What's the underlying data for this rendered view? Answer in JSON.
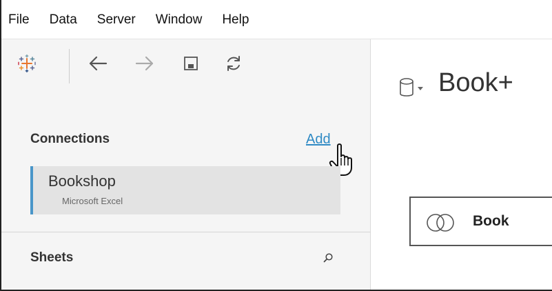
{
  "menubar": {
    "items": [
      "File",
      "Data",
      "Server",
      "Window",
      "Help"
    ]
  },
  "toolbar": {
    "logo": "tableau-logo-icon",
    "buttons": [
      "back-arrow-icon",
      "forward-arrow-icon",
      "save-icon",
      "refresh-icon"
    ]
  },
  "connections": {
    "title": "Connections",
    "add_label": "Add",
    "items": [
      {
        "name": "Bookshop",
        "type": "Microsoft Excel"
      }
    ]
  },
  "sheets": {
    "title": "Sheets",
    "search_icon": "search-icon"
  },
  "canvas": {
    "datasource_name": "Book+",
    "datasource_icon": "database-cylinder-icon",
    "table": {
      "name": "Book",
      "icon": "join-circles-icon"
    }
  },
  "colors": {
    "accent": "#2f8ac4",
    "selection_bar": "#4a96c9",
    "left_pane_bg": "#f5f5f5",
    "selected_item_bg": "#e3e3e3"
  }
}
